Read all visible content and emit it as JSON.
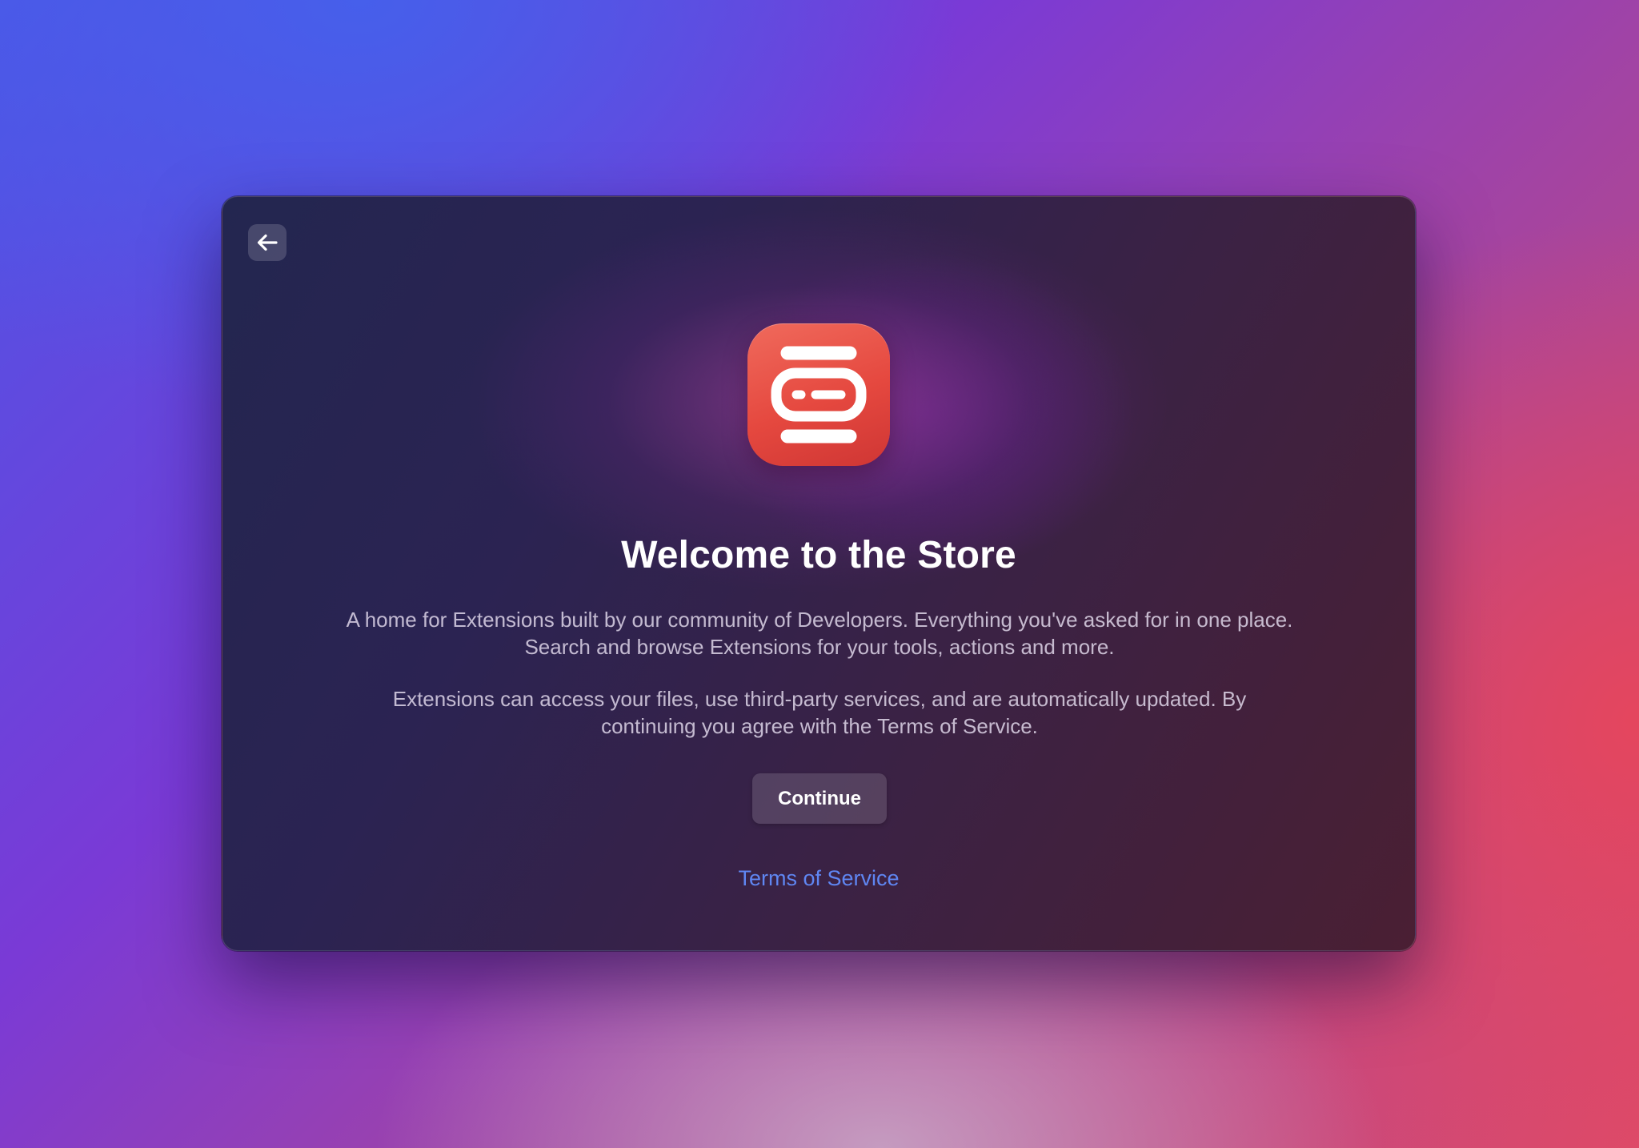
{
  "dialog": {
    "back_button": {
      "icon": "arrow-left-icon"
    },
    "app_icon": {
      "icon": "store-extension-icon",
      "color": "#e5483f"
    },
    "title": "Welcome to the Store",
    "description_1": "A home for Extensions built by our community of Developers. Everything you've asked for in one place. Search and browse Extensions for your tools, actions and more.",
    "description_2": "Extensions can access your files, use third-party services, and are automatically updated. By continuing you agree with the Terms of Service.",
    "continue_label": "Continue",
    "terms_link_label": "Terms of Service",
    "link_color": "#5f86f2"
  }
}
